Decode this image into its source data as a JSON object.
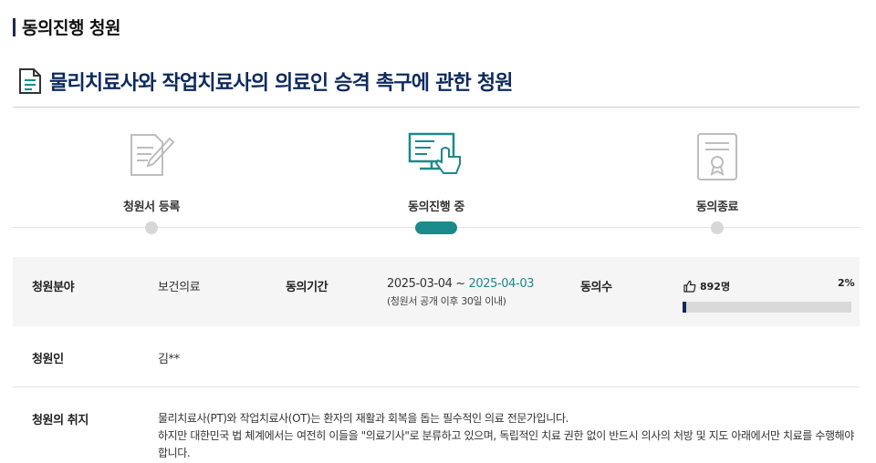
{
  "section": {
    "title": "동의진행 청원"
  },
  "petition": {
    "title": "물리치료사와 작업치료사의 의료인 승격 촉구에 관한 청원",
    "title_icon": "document-icon"
  },
  "steps": [
    {
      "label": "청원서 등록",
      "icon": "pen-paper-icon",
      "state": "done"
    },
    {
      "label": "동의진행 중",
      "icon": "monitor-hand-icon",
      "state": "active"
    },
    {
      "label": "동의종료",
      "icon": "certificate-icon",
      "state": "pending"
    }
  ],
  "info": {
    "field_label": "청원분야",
    "field_value": "보건의료",
    "period_label": "동의기간",
    "period_start": "2025-03-04 ~ ",
    "period_end": "2025-04-03",
    "period_note": "(청원서 공개 이후 30일 이내)",
    "agree_label": "동의수",
    "agree_count": "892명",
    "agree_percent": "2%",
    "agree_fraction": 0.02,
    "agree_icon": "thumbs-up-icon"
  },
  "petitioner": {
    "label": "청원인",
    "value": "김**"
  },
  "purpose": {
    "label": "청원의 취지",
    "lines": [
      "물리치료사(PT)와 작업치료사(OT)는 환자의 재활과 회복을 돕는 필수적인 의료 전문가입니다.",
      "하지만 대한민국 법 체계에서는 여전히 이들을 \"의료기사\"로 분류하고 있으며, 독립적인 치료 권한 없이 반드시 의사의 처방 및 지도 아래에서만 치료를 수행해야 합니다."
    ]
  },
  "colors": {
    "accent": "#1b8a8a",
    "navy": "#0d2a5c",
    "inactive": "#d7d7d7"
  }
}
